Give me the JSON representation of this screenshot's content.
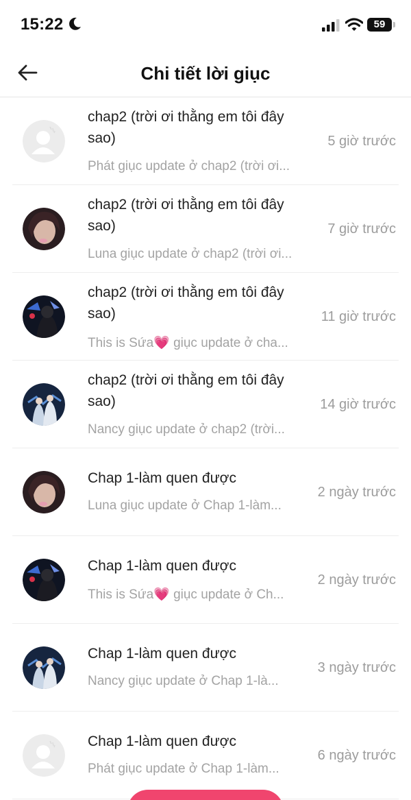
{
  "status": {
    "time": "15:22",
    "battery": "59"
  },
  "header": {
    "title": "Chi tiết lời giục"
  },
  "items": [
    {
      "title": "chap2 (trời ơi thằng em tôi đây sao)",
      "subtitle": "Phát giục update ở chap2 (trời ơi...",
      "time": "5 giờ trước",
      "avatar": "default-avatar-icon"
    },
    {
      "title": "chap2 (trời ơi thằng em tôi đây sao)",
      "subtitle": "Luna giục update ở chap2 (trời ơi...",
      "time": "7 giờ trước",
      "avatar": "user-photo"
    },
    {
      "title": "chap2 (trời ơi thằng em tôi đây sao)",
      "subtitle": "This is Sứa💗 giục update ở cha...",
      "time": "11 giờ trước",
      "avatar": "user-photo"
    },
    {
      "title": "chap2 (trời ơi thằng em tôi đây sao)",
      "subtitle": "Nancy giục update ở chap2 (trời...",
      "time": "14 giờ trước",
      "avatar": "user-photo"
    },
    {
      "title": "Chap 1-làm quen được",
      "subtitle": "Luna giục update ở Chap 1-làm...",
      "time": "2 ngày trước",
      "avatar": "user-photo"
    },
    {
      "title": "Chap 1-làm quen được",
      "subtitle": "This is Sứa💗 giục update ở Ch...",
      "time": "2 ngày trước",
      "avatar": "user-photo"
    },
    {
      "title": "Chap 1-làm quen được",
      "subtitle": "Nancy giục update ở Chap 1-là...",
      "time": "3 ngày trước",
      "avatar": "user-photo"
    },
    {
      "title": "Chap 1-làm quen được",
      "subtitle": "Phát giục update ở Chap 1-làm...",
      "time": "6 ngày trước",
      "avatar": "default-avatar-icon"
    }
  ],
  "colors": {
    "accent": "#f0456e",
    "subtitle": "#a3a3a3",
    "divider": "#ededed"
  }
}
